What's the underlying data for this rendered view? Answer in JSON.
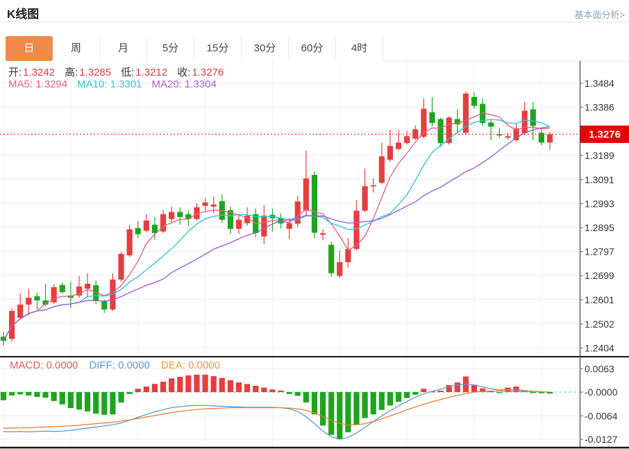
{
  "header": {
    "title": "K线图",
    "link": "基本面分析>"
  },
  "tabs": {
    "items": [
      "日",
      "周",
      "月",
      "5分",
      "15分",
      "30分",
      "60分",
      "4时"
    ],
    "active_index": 0
  },
  "ohlc": {
    "open_label": "开:",
    "open": "1.3242",
    "high_label": "高:",
    "high": "1.3285",
    "low_label": "低:",
    "low": "1.3212",
    "close_label": "收:",
    "close": "1.3276"
  },
  "ma_info": {
    "ma5_label": "MA5:",
    "ma5": "1.3294",
    "ma10_label": "MA10:",
    "ma10": "1.3301",
    "ma20_label": "MA20:",
    "ma20": "1.3304"
  },
  "macd_info": {
    "macd_label": "MACD:",
    "macd": "0.0000",
    "diff_label": "DIFF:",
    "diff": "0.0000",
    "dea_label": "DEA:",
    "dea": "0.0000"
  },
  "price_tag": "1.3276",
  "colors": {
    "up": "#e53e3e",
    "down": "#1ea51e",
    "ma5": "#e8608a",
    "ma10": "#35c3d5",
    "ma20": "#a05fd0",
    "diff": "#5b9bd5",
    "dea": "#ed7d31",
    "tag": "#e60000",
    "dotted": "#f0443c",
    "grid": "#ededed",
    "vgrid": "#f2f2f2",
    "axis": "#444444",
    "zero": "#6cc5b5",
    "active_tab": "#ef8a4c"
  },
  "chart_data": {
    "type": "candlestick+macd",
    "title": "K线图 daily candlestick with MA5/MA10/MA20 and MACD",
    "price_axis_ticks": [
      1.3484,
      1.3386,
      1.3189,
      1.3091,
      1.2993,
      1.2895,
      1.2797,
      1.2699,
      1.2601,
      1.2502,
      1.2404
    ],
    "price_grid_top": 1.3484,
    "price_grid_step": 0.0098,
    "price_grid_count": 12,
    "price_tag_value": 1.3276,
    "macd_axis_ticks": [
      [
        0.0063,
        "0.0063"
      ],
      [
        0,
        "-0.0000"
      ],
      [
        -0.0064,
        "-0.0064"
      ],
      [
        -0.0127,
        "-0.0127"
      ]
    ],
    "ma_periods": [
      5,
      10,
      20
    ],
    "candles": [
      [
        1.245,
        1.247,
        1.2413,
        1.2433
      ],
      [
        1.2441,
        1.2566,
        1.243,
        1.2555
      ],
      [
        1.2527,
        1.2626,
        1.252,
        1.2581
      ],
      [
        1.2581,
        1.2646,
        1.2538,
        1.2609
      ],
      [
        1.2615,
        1.2629,
        1.2561,
        1.2598
      ],
      [
        1.2598,
        1.2666,
        1.2575,
        1.2581
      ],
      [
        1.259,
        1.2663,
        1.2584,
        1.2652
      ],
      [
        1.2661,
        1.2672,
        1.2626,
        1.2632
      ],
      [
        1.2618,
        1.2675,
        1.2567,
        1.2609
      ],
      [
        1.2618,
        1.2697,
        1.2609,
        1.2655
      ],
      [
        1.2646,
        1.2709,
        1.2612,
        1.2666
      ],
      [
        1.266,
        1.268,
        1.2584,
        1.2595
      ],
      [
        1.2595,
        1.2601,
        1.2547,
        1.2561
      ],
      [
        1.2561,
        1.2709,
        1.2555,
        1.2683
      ],
      [
        1.2683,
        1.2797,
        1.2675,
        1.2788
      ],
      [
        1.2782,
        1.2907,
        1.2776,
        1.2888
      ],
      [
        1.2893,
        1.2922,
        1.2851,
        1.2868
      ],
      [
        1.2882,
        1.295,
        1.2876,
        1.2924
      ],
      [
        1.2907,
        1.2938,
        1.2845,
        1.2873
      ],
      [
        1.2879,
        1.2967,
        1.2873,
        1.295
      ],
      [
        1.293,
        1.2981,
        1.2916,
        1.2959
      ],
      [
        1.2959,
        1.2978,
        1.2907,
        1.2938
      ],
      [
        1.295,
        1.2964,
        1.2902,
        1.293
      ],
      [
        1.293,
        1.2995,
        1.2924,
        1.2978
      ],
      [
        1.2984,
        1.3015,
        1.2964,
        1.2998
      ],
      [
        1.2981,
        1.3021,
        1.2953,
        1.2989
      ],
      [
        1.3003,
        1.303,
        1.2916,
        1.2927
      ],
      [
        1.2966,
        1.2981,
        1.287,
        1.289
      ],
      [
        1.289,
        1.295,
        1.287,
        1.2927
      ],
      [
        1.2913,
        1.2978,
        1.2902,
        1.2944
      ],
      [
        1.295,
        1.2973,
        1.2856,
        1.2873
      ],
      [
        1.2859,
        1.2987,
        1.2827,
        1.2944
      ],
      [
        1.2947,
        1.2973,
        1.2879,
        1.2933
      ],
      [
        1.2933,
        1.2953,
        1.2891,
        1.2912
      ],
      [
        1.289,
        1.2933,
        1.2848,
        1.2913
      ],
      [
        1.2911,
        1.3025,
        1.2897,
        1.3002
      ],
      [
        1.2964,
        1.321,
        1.2942,
        1.3096
      ],
      [
        1.311,
        1.3124,
        1.2851,
        1.2874
      ],
      [
        1.2866,
        1.2888,
        1.2843,
        1.2872
      ],
      [
        1.2825,
        1.2838,
        1.2696,
        1.2709
      ],
      [
        1.2698,
        1.2801,
        1.2689,
        1.2754
      ],
      [
        1.2754,
        1.2853,
        1.2732,
        1.2808
      ],
      [
        1.2808,
        1.3007,
        1.2802,
        1.2964
      ],
      [
        1.2964,
        1.3136,
        1.2958,
        1.3064
      ],
      [
        1.3064,
        1.3096,
        1.3038,
        1.3068
      ],
      [
        1.3078,
        1.3242,
        1.3072,
        1.3186
      ],
      [
        1.3172,
        1.3294,
        1.3163,
        1.3228
      ],
      [
        1.3216,
        1.3294,
        1.321,
        1.3242
      ],
      [
        1.324,
        1.329,
        1.3234,
        1.3268
      ],
      [
        1.3258,
        1.3312,
        1.3252,
        1.3296
      ],
      [
        1.3266,
        1.3422,
        1.326,
        1.338
      ],
      [
        1.3366,
        1.3428,
        1.3308,
        1.3322
      ],
      [
        1.3338,
        1.3344,
        1.3224,
        1.324
      ],
      [
        1.324,
        1.335,
        1.3234,
        1.3344
      ],
      [
        1.3338,
        1.338,
        1.328,
        1.3316
      ],
      [
        1.3282,
        1.345,
        1.3272,
        1.3442
      ],
      [
        1.3428,
        1.3448,
        1.338,
        1.3392
      ],
      [
        1.34,
        1.3422,
        1.3308,
        1.3322
      ],
      [
        1.3324,
        1.3338,
        1.3252,
        1.3307
      ],
      [
        1.3276,
        1.3302,
        1.3262,
        1.3271
      ],
      [
        1.3262,
        1.3282,
        1.3254,
        1.3268
      ],
      [
        1.3252,
        1.3318,
        1.3246,
        1.33
      ],
      [
        1.328,
        1.3408,
        1.3271,
        1.3372
      ],
      [
        1.3378,
        1.3408,
        1.3252,
        1.331
      ],
      [
        1.3282,
        1.3302,
        1.3232,
        1.3242
      ],
      [
        1.3242,
        1.3285,
        1.3212,
        1.3276
      ]
    ],
    "macd": {
      "hist": [
        -0.0022,
        -0.0009,
        -0.0006,
        -0.0009,
        -0.0013,
        -0.0015,
        -0.0024,
        -0.0033,
        -0.0043,
        -0.0047,
        -0.0052,
        -0.0058,
        -0.0061,
        -0.006,
        -0.0028,
        -0.0005,
        0.0009,
        0.0015,
        0.0022,
        0.0028,
        0.0037,
        0.0041,
        0.0045,
        0.0047,
        0.0047,
        0.0043,
        0.0038,
        0.0032,
        0.0026,
        0.0022,
        0.0017,
        0.0012,
        0.0007,
        0.0004,
        -0.0005,
        -0.001,
        -0.0028,
        -0.006,
        -0.009,
        -0.0115,
        -0.0127,
        -0.0108,
        -0.0088,
        -0.007,
        -0.006,
        -0.0048,
        -0.0036,
        -0.0026,
        -0.0016,
        -0.0007,
        0.0009,
        0.0002,
        0.0004,
        0.0019,
        0.0026,
        0.0042,
        0.002,
        0.001,
        0.0003,
        -0.0002,
        0.0012,
        0.0015,
        0.0005,
        -0.0002,
        -0.0003,
        -0.0004
      ],
      "diff": [
        -0.0106,
        -0.0107,
        -0.0106,
        -0.0107,
        -0.0106,
        -0.0105,
        -0.0106,
        -0.0105,
        -0.0103,
        -0.01,
        -0.0097,
        -0.0094,
        -0.0091,
        -0.0088,
        -0.0083,
        -0.0076,
        -0.0068,
        -0.006,
        -0.0053,
        -0.0047,
        -0.0042,
        -0.0039,
        -0.0037,
        -0.0036,
        -0.0036,
        -0.0037,
        -0.0038,
        -0.0039,
        -0.004,
        -0.0041,
        -0.0041,
        -0.0041,
        -0.0041,
        -0.0042,
        -0.0045,
        -0.0052,
        -0.0066,
        -0.0085,
        -0.0105,
        -0.012,
        -0.0127,
        -0.0122,
        -0.011,
        -0.0095,
        -0.0079,
        -0.0064,
        -0.005,
        -0.0037,
        -0.0025,
        -0.0014,
        -0.0005,
        0.0002,
        0.0008,
        0.0014,
        0.0019,
        0.0021,
        0.0019,
        0.0014,
        0.0009,
        0.0006,
        0.0007,
        0.0008,
        0.0004,
        0.0002,
        0.0001,
        0.0
      ],
      "dea": [
        -0.0097,
        -0.0097,
        -0.0096,
        -0.0096,
        -0.0095,
        -0.0094,
        -0.0093,
        -0.0092,
        -0.0091,
        -0.0089,
        -0.0087,
        -0.0085,
        -0.0083,
        -0.0081,
        -0.0078,
        -0.0075,
        -0.0071,
        -0.0067,
        -0.0063,
        -0.0059,
        -0.0055,
        -0.0052,
        -0.0049,
        -0.0047,
        -0.0045,
        -0.0044,
        -0.0043,
        -0.0042,
        -0.0042,
        -0.0042,
        -0.0042,
        -0.0042,
        -0.0042,
        -0.0042,
        -0.0043,
        -0.0045,
        -0.0049,
        -0.0056,
        -0.0066,
        -0.0076,
        -0.0084,
        -0.0088,
        -0.0088,
        -0.0085,
        -0.0079,
        -0.0072,
        -0.0064,
        -0.0056,
        -0.0048,
        -0.004,
        -0.0033,
        -0.0026,
        -0.002,
        -0.0014,
        -0.0009,
        -0.0004,
        0.0,
        0.0002,
        0.0003,
        0.0003,
        0.0003,
        0.0003,
        0.0002,
        0.0002,
        0.0001,
        0.0
      ]
    }
  }
}
